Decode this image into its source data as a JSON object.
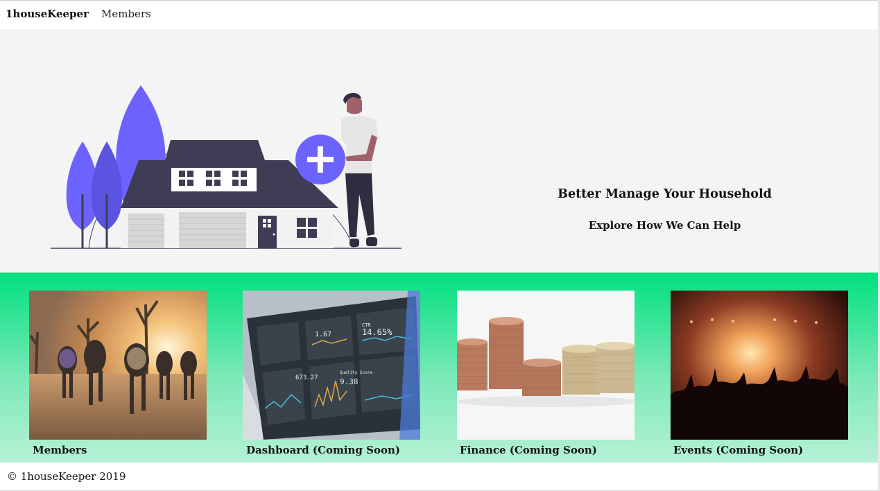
{
  "navbar": {
    "brand": "1houseKeeper",
    "links": [
      {
        "label": "Members"
      }
    ]
  },
  "hero": {
    "title": "Better Manage Your Household",
    "subtitle": "Explore How We Can Help",
    "illustration_icon": "house-with-person-plus-illustration",
    "accent_color": "#6c63ff"
  },
  "features": {
    "gradient_colors": [
      "#00e07e",
      "#b6f1d6"
    ],
    "cards": [
      {
        "label": "Members",
        "image": "friends-running-desert-photo"
      },
      {
        "label": "Dashboard (Coming Soon)",
        "image": "analytics-dashboard-screen-photo"
      },
      {
        "label": "Finance (Coming Soon)",
        "image": "coin-stacks-photo"
      },
      {
        "label": "Events (Coming Soon)",
        "image": "concert-crowd-photo"
      }
    ]
  },
  "footer": {
    "copyright": "© 1houseKeeper 2019"
  }
}
